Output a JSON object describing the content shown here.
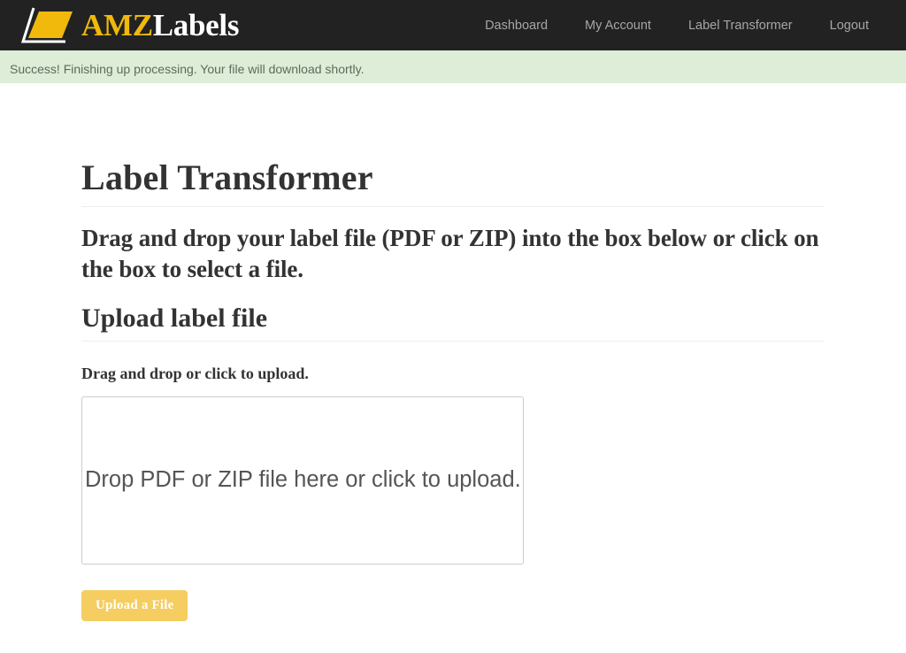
{
  "header": {
    "brand": {
      "mark_icon": "amz-parallelogram-logo-icon",
      "text_primary": "AMZ",
      "text_secondary": "Labels"
    },
    "nav": [
      {
        "label": "Dashboard",
        "name": "nav-link-dashboard"
      },
      {
        "label": "My Account",
        "name": "nav-link-my-account"
      },
      {
        "label": "Label Transformer",
        "name": "nav-link-label-transformer"
      },
      {
        "label": "Logout",
        "name": "nav-link-logout"
      }
    ],
    "background_color": "#222222",
    "brand_accent_color": "#f0b90b"
  },
  "alert": {
    "message": "Success! Finishing up processing. Your file will download shortly.",
    "type": "success",
    "background_color": "#ddedd7",
    "text_color": "#5d6b5d"
  },
  "main": {
    "page_title": "Label Transformer",
    "lead": "Drag and drop your label file (PDF or ZIP) into the box below or click on the box to select a file.",
    "section_title": "Upload label file",
    "field_label": "Drag and drop or click to upload.",
    "dropzone_text": "Drop PDF or ZIP file here or click to upload.",
    "upload_button_label": "Upload a File",
    "upload_button_color": "#f5cd60"
  }
}
